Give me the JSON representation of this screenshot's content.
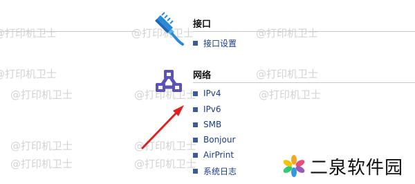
{
  "watermark": "@打印机卫士",
  "sections": [
    {
      "title": "接口",
      "icon": "network-cable-icon",
      "links": [
        "接口设置"
      ]
    },
    {
      "title": "网络",
      "icon": "network-topology-icon",
      "links": [
        "IPv4",
        "IPv6",
        "SMB",
        "Bonjour",
        "AirPrint",
        "系统日志"
      ]
    }
  ],
  "annotation": {
    "icon": "red-arrow-icon",
    "color": "#e02020"
  },
  "brand": {
    "name": "二泉软件园",
    "icon": "pinwheel-logo-icon"
  },
  "colors": {
    "link": "#1a3c8a",
    "bullet": "#3a5a9a",
    "cable_icon": "#2a8ad8",
    "network_icon": "#5a52b8"
  }
}
